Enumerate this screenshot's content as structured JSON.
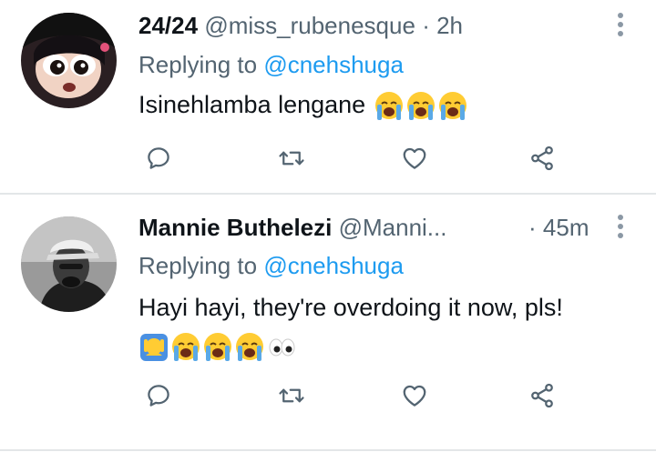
{
  "tweets": [
    {
      "display_name": "24/24",
      "handle": "@miss_rubenesque",
      "separator": "·",
      "time": "2h",
      "replying_prefix": "Replying to ",
      "replying_to": "@cnehshuga",
      "text": "Isinehlamba lengane",
      "emojis": [
        "crying-face",
        "crying-face",
        "crying-face"
      ]
    },
    {
      "display_name": "Mannie Buthelezi",
      "handle": "@Manni...",
      "separator": "·",
      "time": "45m",
      "replying_prefix": "Replying to ",
      "replying_to": "@cnehshuga",
      "text": "Hayi hayi, they're overdoing it now, pls!",
      "emojis": [
        "person-facepalming",
        "crying-face",
        "crying-face",
        "crying-face",
        "eyes"
      ]
    }
  ],
  "colors": {
    "accent": "#1d9bf0",
    "secondary_text": "#536471",
    "icon": "#536471",
    "divider": "#e3e6e8"
  }
}
